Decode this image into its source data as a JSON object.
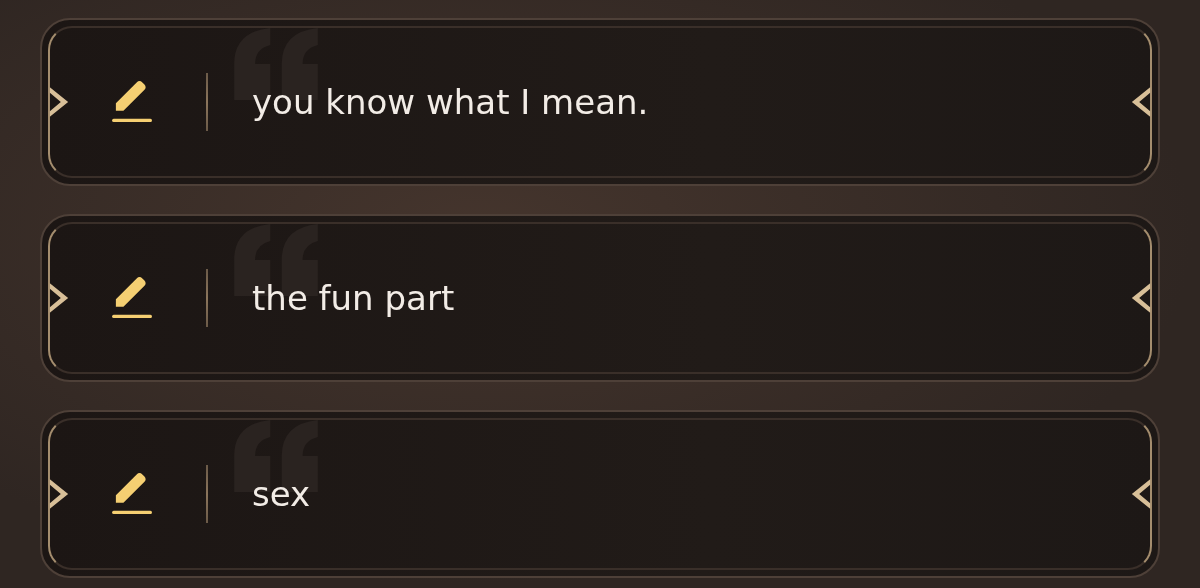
{
  "options": [
    {
      "text": "you know what I mean."
    },
    {
      "text": "the fun part"
    },
    {
      "text": "sex"
    }
  ]
}
